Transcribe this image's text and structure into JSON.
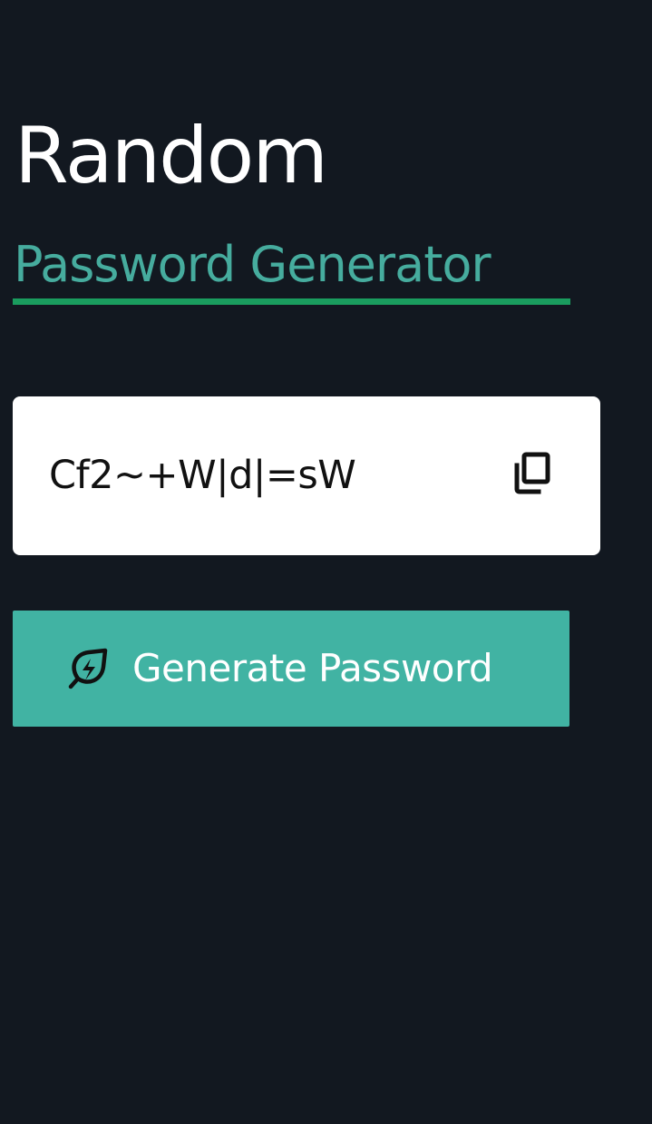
{
  "header": {
    "title": "Random",
    "subtitle": "Password Generator"
  },
  "password": {
    "value": "Cf2~+W|d|=sW",
    "copy_icon": "copy-icon"
  },
  "generate": {
    "label": "Generate Password",
    "icon": "bolt-leaf-icon"
  },
  "colors": {
    "background": "#121820",
    "accent": "#41b3a3",
    "subtitle": "#46ac9e",
    "underline": "#1a9c5e",
    "card": "#ffffff"
  }
}
